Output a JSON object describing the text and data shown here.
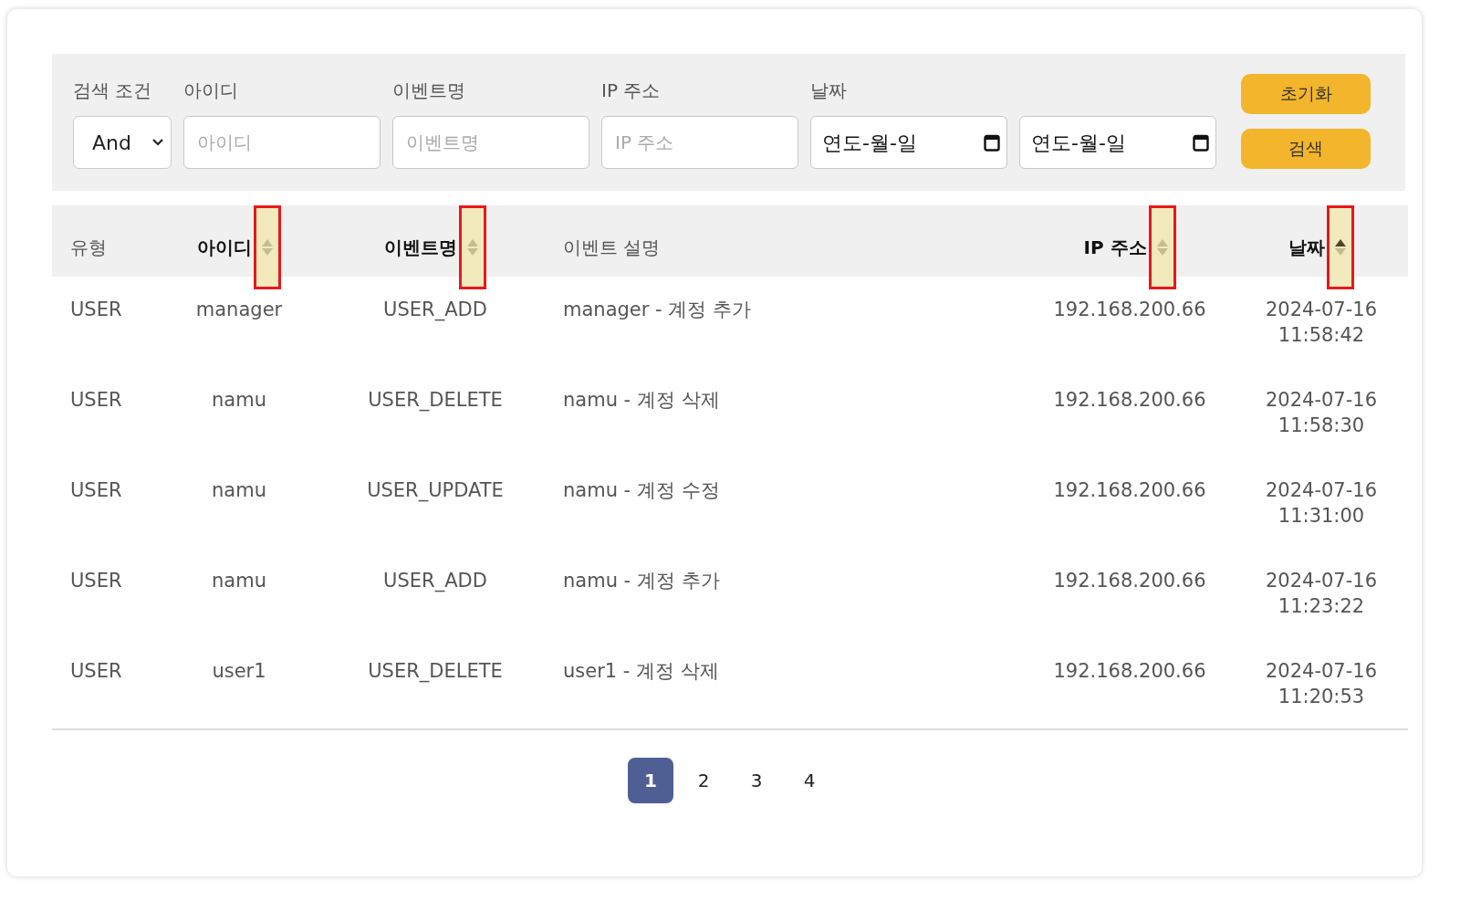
{
  "filters": {
    "condition": {
      "label": "검색 조건",
      "value": "And"
    },
    "fields": [
      {
        "kind": "text",
        "label": "아이디",
        "placeholder": "아이디"
      },
      {
        "kind": "text",
        "label": "이벤트명",
        "placeholder": "이벤트명"
      },
      {
        "kind": "text",
        "label": "IP 주소",
        "placeholder": "IP 주소"
      },
      {
        "kind": "date",
        "label": "날짜",
        "placeholder": "연도-월-일"
      },
      {
        "kind": "date",
        "placeholder": "연도-월-일"
      }
    ],
    "buttons": [
      "초기화",
      "검색"
    ]
  },
  "table": {
    "columns": [
      {
        "label": "유형",
        "kind": "plain"
      },
      {
        "label": "아이디",
        "kind": "sortable",
        "sorted_ascending": false
      },
      {
        "label": "이벤트명",
        "kind": "sortable",
        "sorted_ascending": false
      },
      {
        "label": "이벤트 설명",
        "kind": "plain"
      },
      {
        "label": "IP 주소",
        "kind": "sortable",
        "sorted_ascending": false
      },
      {
        "label": "날짜",
        "kind": "sortable",
        "sorted_ascending": true
      }
    ],
    "rows": [
      [
        "USER",
        "manager",
        "USER_ADD",
        "manager - 계정 추가",
        "192.168.200.66",
        "2024-07-16 11:58:42"
      ],
      [
        "USER",
        "namu",
        "USER_DELETE",
        "namu - 계정 삭제",
        "192.168.200.66",
        "2024-07-16 11:58:30"
      ],
      [
        "USER",
        "namu",
        "USER_UPDATE",
        "namu - 계정 수정",
        "192.168.200.66",
        "2024-07-16 11:31:00"
      ],
      [
        "USER",
        "namu",
        "USER_ADD",
        "namu - 계정 추가",
        "192.168.200.66",
        "2024-07-16 11:23:22"
      ],
      [
        "USER",
        "user1",
        "USER_DELETE",
        "user1 - 계정 삭제",
        "192.168.200.66",
        "2024-07-16 11:20:53"
      ]
    ]
  },
  "pagination": [
    {
      "label": "1",
      "selected": true
    },
    {
      "label": "2",
      "selected": false
    },
    {
      "label": "3",
      "selected": false
    },
    {
      "label": "4",
      "selected": false
    }
  ]
}
